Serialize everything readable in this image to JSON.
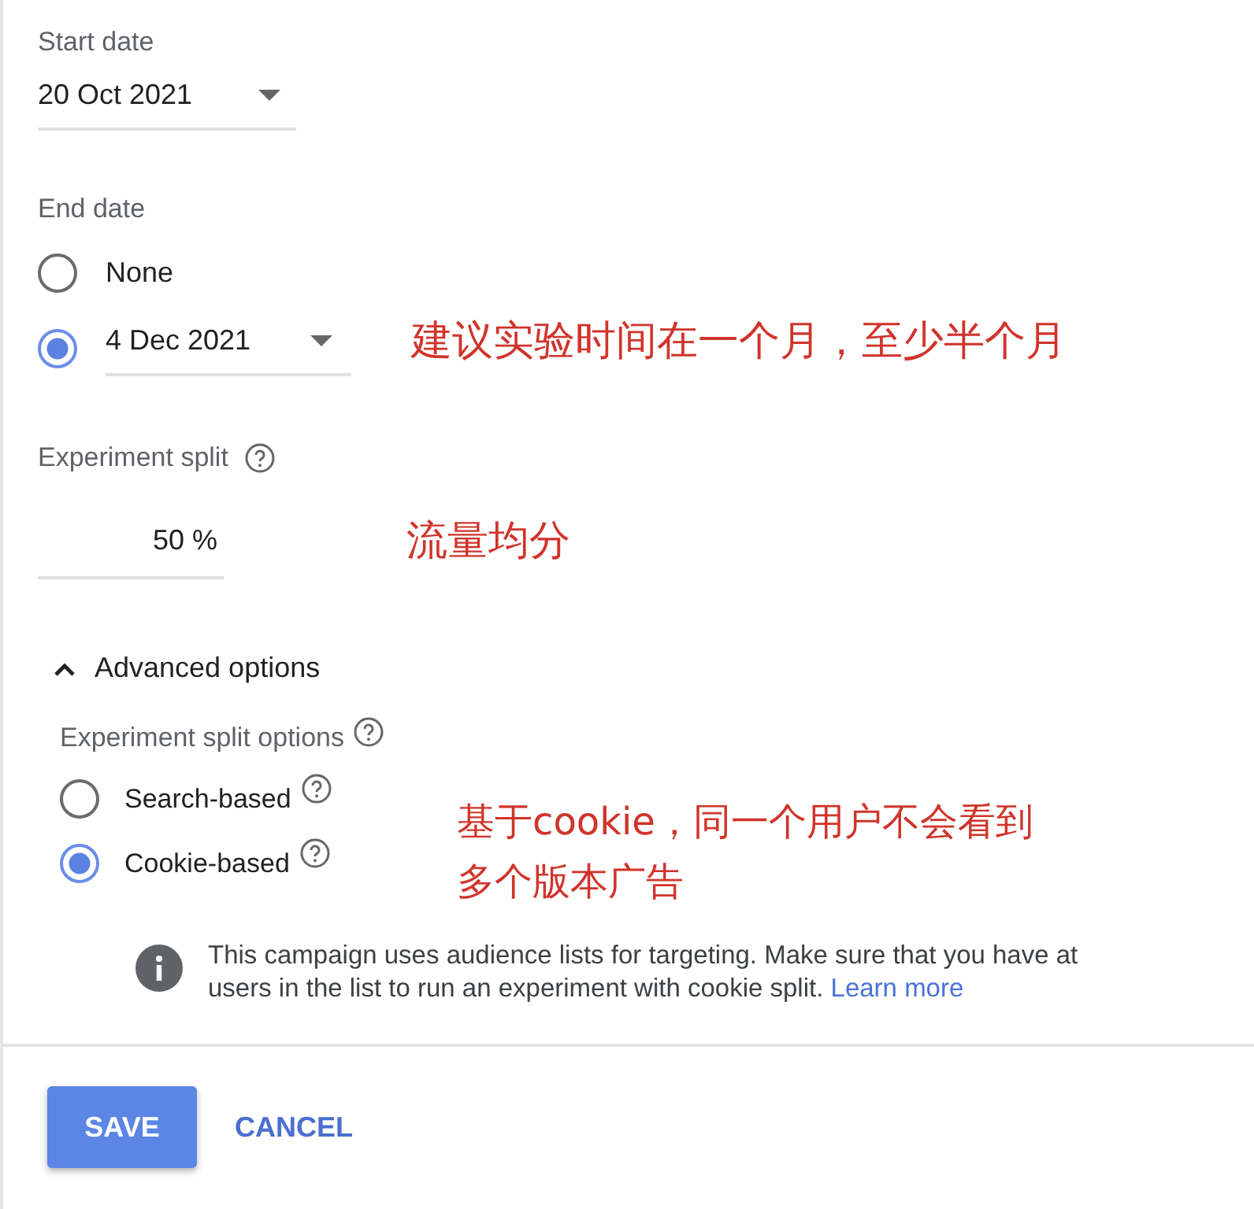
{
  "start_date": {
    "label": "Start date",
    "value": "20 Oct 2021"
  },
  "end_date": {
    "label": "End date",
    "options": [
      {
        "kind": "text",
        "label": "None",
        "selected": false
      },
      {
        "kind": "date",
        "value": "4 Dec 2021",
        "selected": true
      }
    ]
  },
  "end_date_note": "建议实验时间在一个月，至少半个月",
  "experiment_split": {
    "label": "Experiment split",
    "value": "50 %"
  },
  "split_note": "流量均分",
  "advanced_options": {
    "label": "Advanced options",
    "expanded": true
  },
  "split_options": {
    "label": "Experiment split options",
    "options": [
      {
        "label": "Search-based",
        "selected": false
      },
      {
        "label": "Cookie-based",
        "selected": true
      }
    ]
  },
  "split_options_note": [
    "基于cookie，同一个用户不会看到",
    "多个版本广告"
  ],
  "info": {
    "line_1": "This campaign uses audience lists for targeting. Make sure that you have at",
    "line_2": "users in the list to run an experiment with cookie split.",
    "link": "Learn more"
  },
  "buttons": {
    "save": "SAVE",
    "cancel": "CANCEL"
  }
}
